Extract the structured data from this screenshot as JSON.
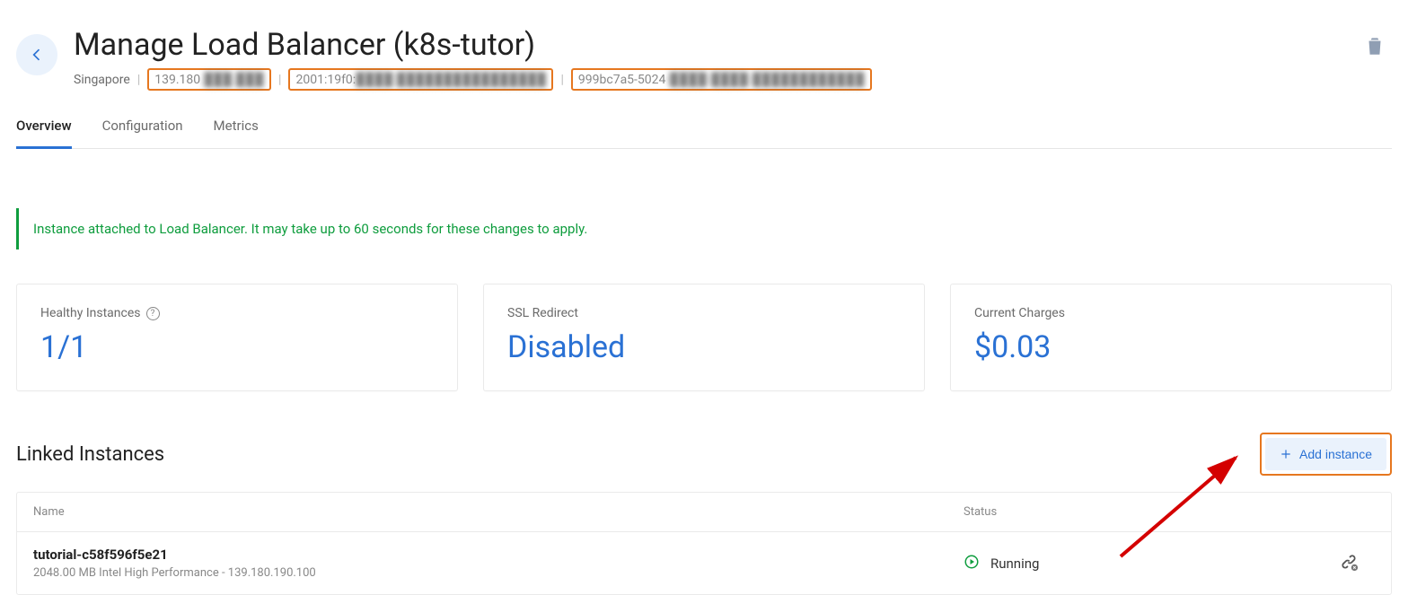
{
  "header": {
    "title": "Manage Load Balancer (k8s-tutor)"
  },
  "meta": {
    "region": "Singapore",
    "ip_v4_prefix": "139.180",
    "ip_v4_redacted": ".███.███",
    "ip_v6_prefix": "2001:19f0:",
    "ip_v6_redacted": "████:████████████████",
    "uuid_prefix": "999bc7a5-5024",
    "uuid_redacted": "-████-████-████████████"
  },
  "tabs": {
    "overview": "Overview",
    "configuration": "Configuration",
    "metrics": "Metrics"
  },
  "alert": {
    "message": "Instance attached to Load Balancer. It may take up to 60 seconds for these changes to apply."
  },
  "cards": {
    "healthy": {
      "label": "Healthy Instances",
      "value": "1/1"
    },
    "ssl": {
      "label": "SSL Redirect",
      "value": "Disabled"
    },
    "charges": {
      "label": "Current Charges",
      "value": "$0.03"
    }
  },
  "linked": {
    "title": "Linked Instances",
    "add_label": "Add instance",
    "columns": {
      "name": "Name",
      "status": "Status"
    },
    "rows": [
      {
        "name": "tutorial-c58f596f5e21",
        "sub": "2048.00 MB Intel High Performance - 139.180.190.100",
        "status": "Running"
      }
    ]
  }
}
